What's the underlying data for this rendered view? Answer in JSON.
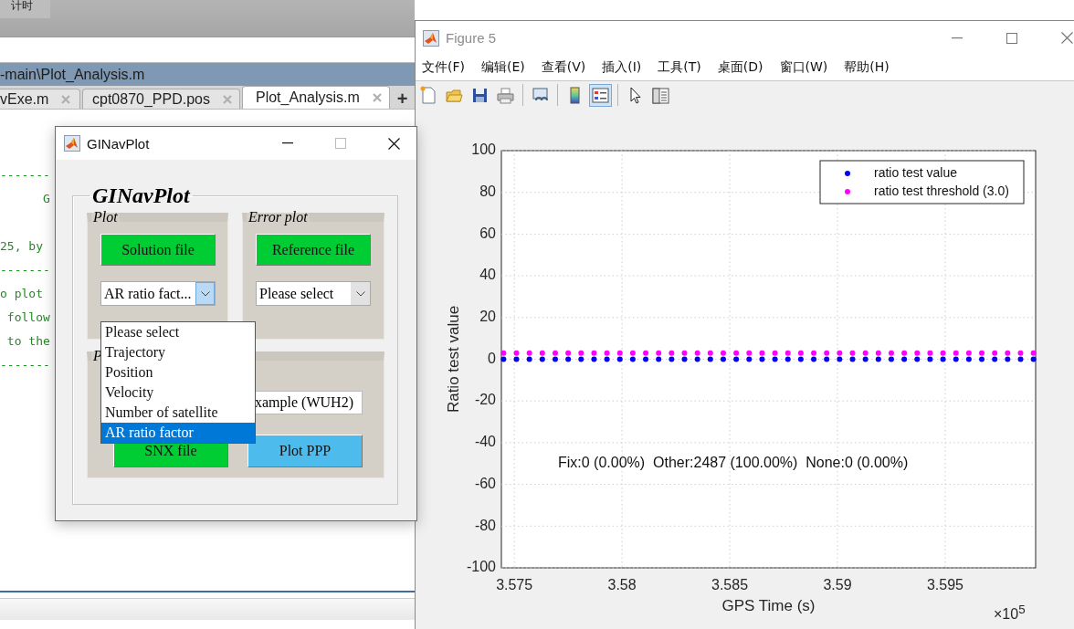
{
  "editor": {
    "top_label": "计时",
    "path": "-main\\Plot_Analysis.m",
    "tabs": [
      {
        "label": "vExe.m",
        "selected": false
      },
      {
        "label": "cpt0870_PPD.pos",
        "selected": false
      },
      {
        "label": "Plot_Analysis.m",
        "selected": true
      }
    ],
    "new_tab": "+",
    "code_lines": [
      "-------",
      "      G",
      "25, by",
      "-------",
      "o plot",
      " follow",
      " to the",
      "-------"
    ]
  },
  "ginavplot": {
    "title": "GINavPlot",
    "heading": "GINavPlot",
    "panels": [
      {
        "title": "Plot",
        "button": "Solution file",
        "dropdown": {
          "value": "AR ratio fact...",
          "focused": true
        }
      },
      {
        "title": "Error plot",
        "button": "Reference file",
        "dropdown": {
          "value": "Please select",
          "focused": false
        }
      }
    ],
    "bottom_panel": {
      "title": "P",
      "field_value": "xample (WUH2)",
      "buttons": [
        {
          "label": "SNX file",
          "color": "#00cc33"
        },
        {
          "label": "Plot PPP",
          "color": "#4dbbeb"
        }
      ]
    },
    "dropdown_list": [
      {
        "label": "Please select",
        "selected": false
      },
      {
        "label": "Trajectory",
        "selected": false
      },
      {
        "label": "Position",
        "selected": false
      },
      {
        "label": "Velocity",
        "selected": false
      },
      {
        "label": "Number of satellite",
        "selected": false
      },
      {
        "label": "AR ratio factor",
        "selected": true
      }
    ]
  },
  "figure": {
    "title": "Figure 5",
    "menu": [
      "文件(F)",
      "编辑(E)",
      "查看(V)",
      "插入(I)",
      "工具(T)",
      "桌面(D)",
      "窗口(W)",
      "帮助(H)"
    ],
    "toolbar": [
      {
        "kind": "new",
        "pressed": false
      },
      {
        "kind": "open",
        "pressed": false
      },
      {
        "kind": "save",
        "pressed": false
      },
      {
        "kind": "print",
        "pressed": false
      },
      {
        "kind": "separator"
      },
      {
        "kind": "link",
        "pressed": false
      },
      {
        "kind": "separator"
      },
      {
        "kind": "colorbar",
        "pressed": false
      },
      {
        "kind": "legend",
        "pressed": true
      },
      {
        "kind": "separator"
      },
      {
        "kind": "pointer",
        "pressed": false
      },
      {
        "kind": "inspector",
        "pressed": false
      }
    ],
    "stats_text": "Fix:0 (0.00%)  Other:2487 (100.00%)  None:0 (0.00%)",
    "x_exponent": "×10$^{5}$",
    "chart_data": {
      "type": "scatter",
      "xlabel": "GPS Time (s)",
      "ylabel": "Ratio test value",
      "x": [
        3.5745,
        3.5751,
        3.5757,
        3.5763,
        3.5769,
        3.5775,
        3.5781,
        3.5787,
        3.5793,
        3.5799,
        3.5805,
        3.5811,
        3.5817,
        3.5823,
        3.5829,
        3.5835,
        3.5841,
        3.5847,
        3.5853,
        3.5859,
        3.5865,
        3.5871,
        3.5877,
        3.5883,
        3.5889,
        3.5895,
        3.5901,
        3.5907,
        3.5913,
        3.5919,
        3.5925,
        3.5931,
        3.5937,
        3.5943,
        3.5949,
        3.5955,
        3.5961,
        3.5967,
        3.5973,
        3.5979,
        3.5985,
        3.5991
      ],
      "series": [
        {
          "name": "ratio test value",
          "color": "#0000ff",
          "values": [
            0,
            0,
            0,
            0,
            0,
            0,
            0,
            0,
            0,
            0,
            0,
            0,
            0,
            0,
            0,
            0,
            0,
            0,
            0,
            0,
            0,
            0,
            0,
            0,
            0,
            0,
            0,
            0,
            0,
            0,
            0,
            0,
            0,
            0,
            0,
            0,
            0,
            0,
            0,
            0,
            0,
            0
          ]
        },
        {
          "name": "ratio test threshold (3.0)",
          "color": "#ff00ff",
          "values": [
            3,
            3,
            3,
            3,
            3,
            3,
            3,
            3,
            3,
            3,
            3,
            3,
            3,
            3,
            3,
            3,
            3,
            3,
            3,
            3,
            3,
            3,
            3,
            3,
            3,
            3,
            3,
            3,
            3,
            3,
            3,
            3,
            3,
            3,
            3,
            3,
            3,
            3,
            3,
            3,
            3,
            3
          ]
        }
      ],
      "xlim": [
        3.5744,
        3.5992
      ],
      "ylim": [
        -100,
        100
      ],
      "xticks": [
        3.575,
        3.58,
        3.585,
        3.59,
        3.595
      ],
      "yticks": [
        100,
        80,
        60,
        40,
        20,
        0,
        -20,
        -40,
        -60,
        -80,
        -100
      ],
      "grid": true,
      "legend": true
    }
  }
}
